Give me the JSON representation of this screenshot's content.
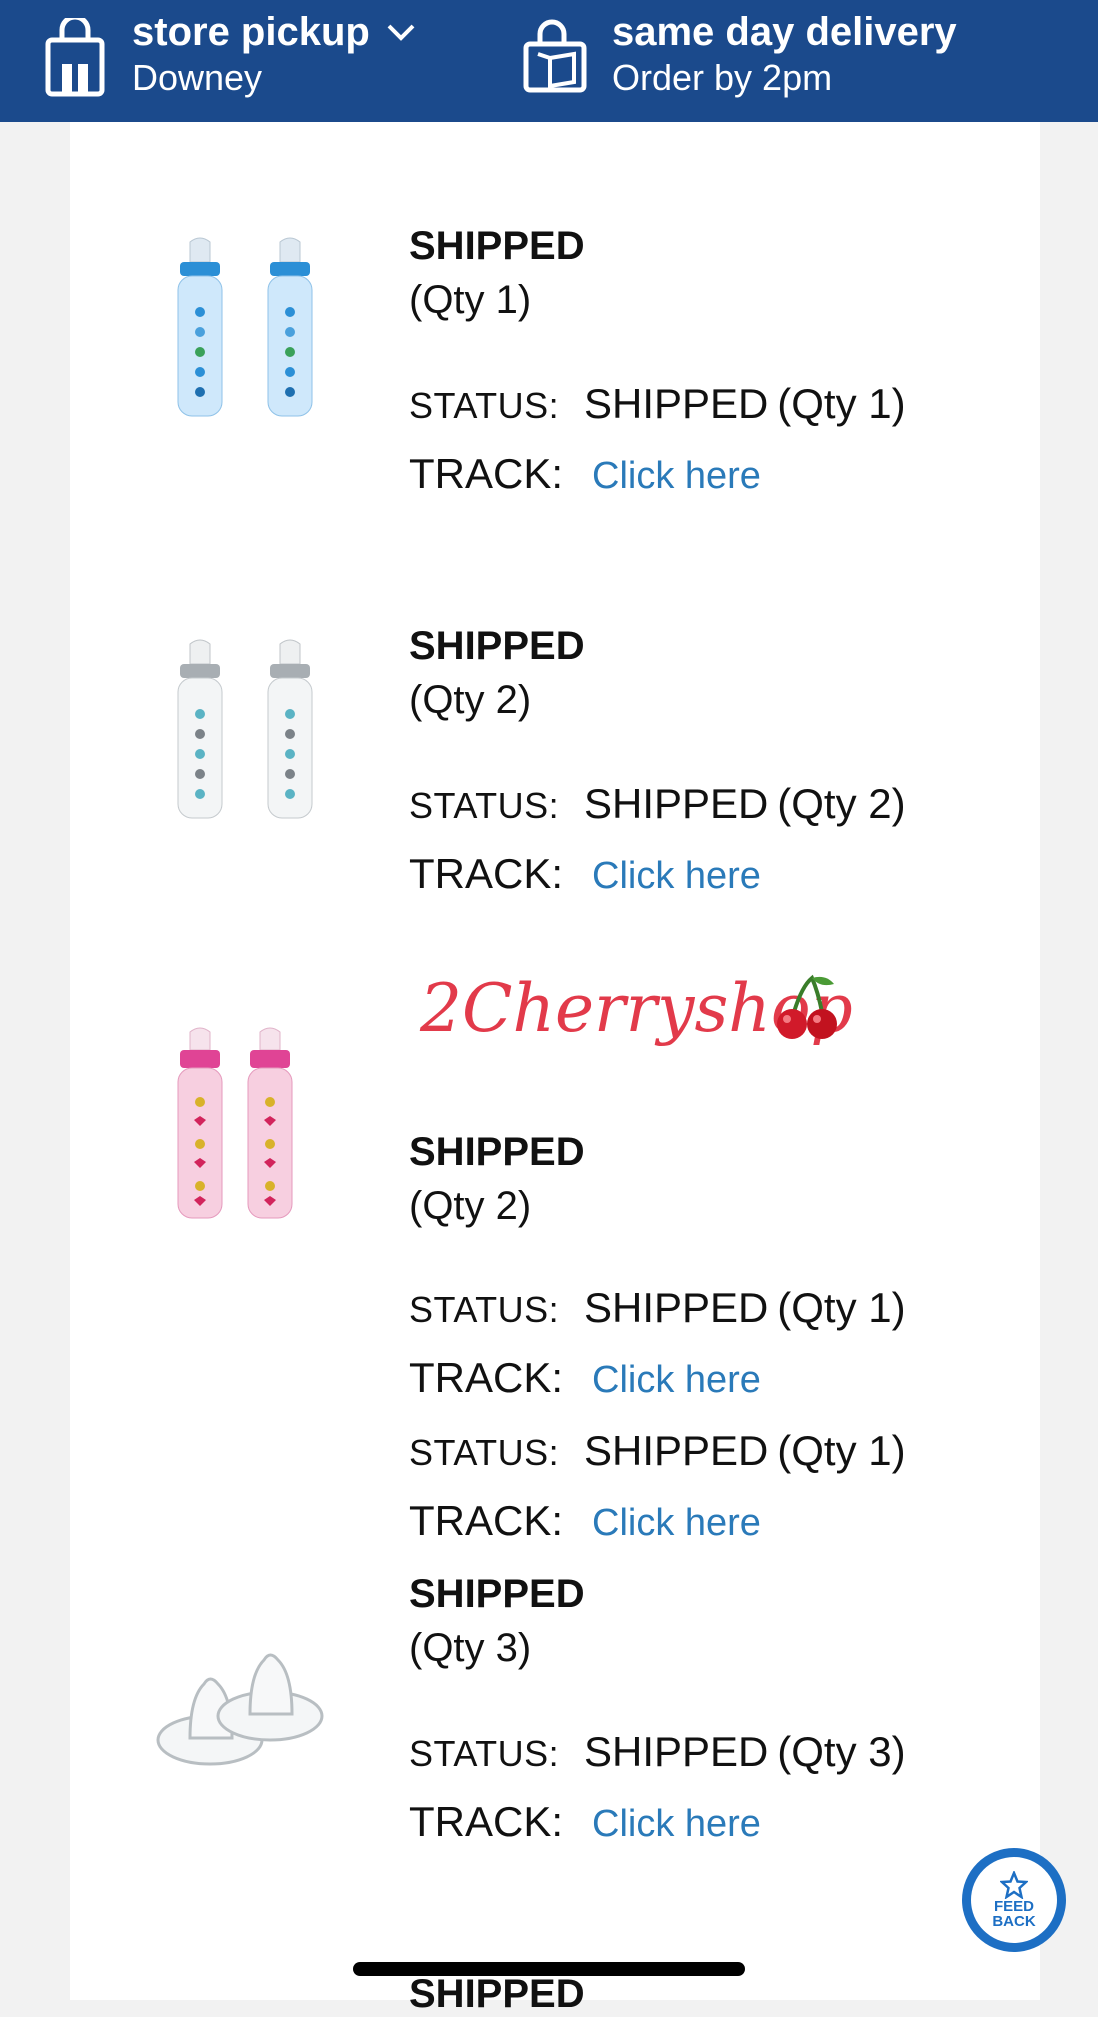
{
  "header": {
    "pickup": {
      "title": "store pickup",
      "location": "Downey",
      "icon": "store-bag-icon"
    },
    "delivery": {
      "title": "same day delivery",
      "note": "Order by 2pm",
      "icon": "delivery-box-icon"
    }
  },
  "labels": {
    "status": "STATUS:",
    "track": "TRACK:"
  },
  "items": [
    {
      "title": "SHIPPED",
      "qty": "(Qty 1)",
      "product": "blue baby bottles",
      "color": "#2b8fd6",
      "rows": [
        {
          "status": "SHIPPED",
          "qty": "(Qty 1)",
          "link": "Click here"
        }
      ]
    },
    {
      "title": "SHIPPED",
      "qty": "(Qty 2)",
      "product": "clear baby bottles",
      "color": "#9aa2a8",
      "rows": [
        {
          "status": "SHIPPED",
          "qty": "(Qty 2)",
          "link": "Click here"
        }
      ]
    },
    {
      "title": "SHIPPED",
      "qty": "(Qty 2)",
      "product": "pink baby bottles",
      "color": "#e04495",
      "rows": [
        {
          "status": "SHIPPED",
          "qty": "(Qty 1)",
          "link": "Click here"
        },
        {
          "status": "SHIPPED",
          "qty": "(Qty 1)",
          "link": "Click here"
        }
      ]
    },
    {
      "title": "SHIPPED",
      "qty": "(Qty 3)",
      "product": "bottle nipples",
      "rows": [
        {
          "status": "SHIPPED",
          "qty": "(Qty 3)",
          "link": "Click here"
        }
      ]
    }
  ],
  "watermark": "2Cherryshop",
  "next_item_title": "SHIPPED",
  "feedback": {
    "line1": "FEED",
    "line2": "BACK",
    "icon": "star-icon"
  }
}
